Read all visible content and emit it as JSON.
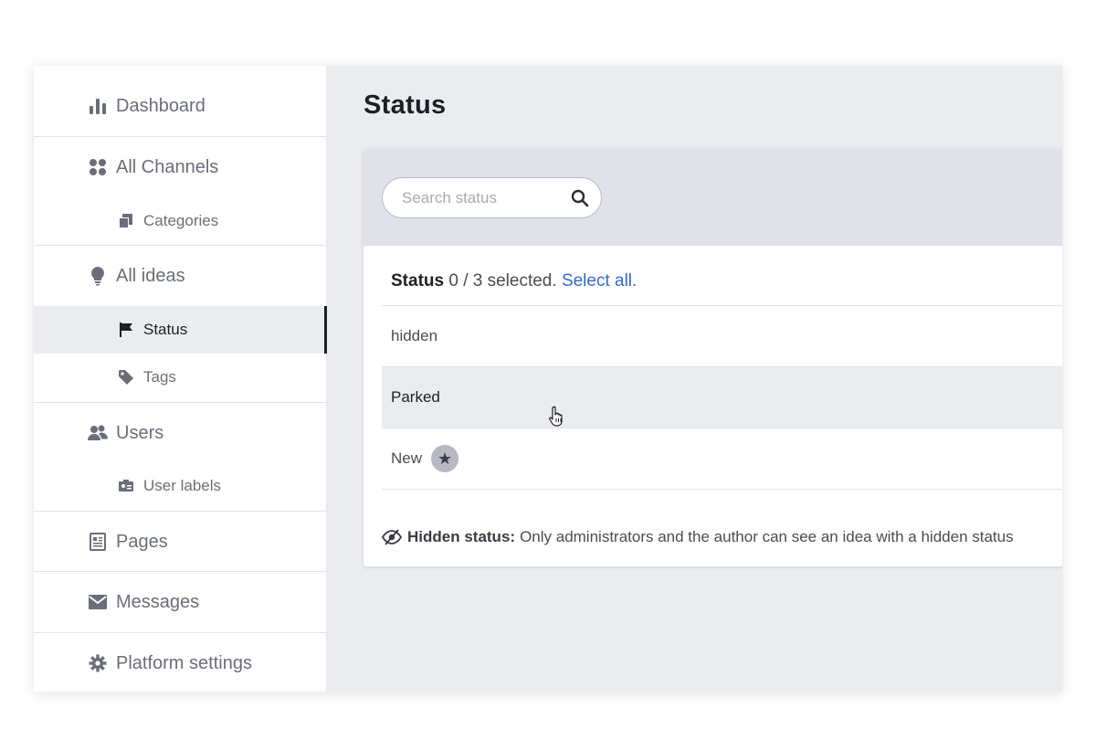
{
  "sidebar": {
    "dashboard": "Dashboard",
    "all_channels": "All Channels",
    "categories": "Categories",
    "all_ideas": "All ideas",
    "status": "Status",
    "tags": "Tags",
    "users": "Users",
    "user_labels": "User labels",
    "pages": "Pages",
    "messages": "Messages",
    "platform_settings": "Platform settings",
    "active_item": "Status"
  },
  "main": {
    "title": "Status",
    "search_placeholder": "Search status",
    "selection": {
      "label": "Status",
      "count_text": "0 / 3 selected.",
      "select_all": "Select all."
    },
    "rows": [
      "hidden",
      "Parked",
      "New"
    ],
    "hovered_row": "Parked",
    "default_badge_icon": "star-icon",
    "footnote_label": "Hidden status:",
    "footnote_text": "Only administrators and the author can see an idea with a hidden status"
  },
  "colors": {
    "link": "#3569c7",
    "active_border": "#1e1f26",
    "header_bg": "#e1e2e9"
  }
}
